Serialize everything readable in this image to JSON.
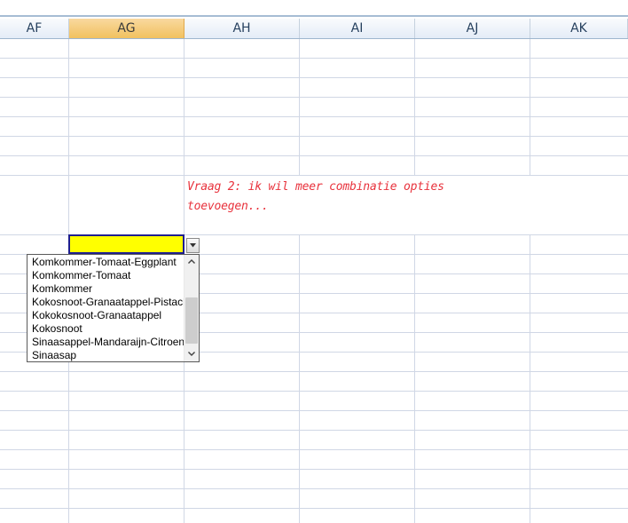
{
  "columns": [
    {
      "label": "AF",
      "selected": false
    },
    {
      "label": "AG",
      "selected": true
    },
    {
      "label": "AH",
      "selected": false
    },
    {
      "label": "AI",
      "selected": false
    },
    {
      "label": "AJ",
      "selected": false
    },
    {
      "label": "AK",
      "selected": false
    }
  ],
  "note": {
    "text": "Vraag 2: ik wil meer combinatie opties toevoegen...",
    "color": "#e8323c"
  },
  "active_cell": {
    "fill_color": "#ffff00"
  },
  "dropdown": {
    "items": [
      "Komkommer-Tomaat-Eggplant",
      "Komkommer-Tomaat",
      "Komkommer",
      "Kokosnoot-Granaatappel-Pistache",
      "Kokokosnoot-Granaatappel",
      "Kokosnoot",
      "Sinaasappel-Mandaraijn-Citroen",
      "Sinaasap"
    ],
    "up_icon": "chevron-up-icon",
    "down_icon": "chevron-down-icon",
    "button_icon": "dropdown-arrow-icon"
  },
  "colors": {
    "selected_header": "#f1c15f",
    "grid_line": "#d0d7e5",
    "header_text": "#27415f"
  }
}
